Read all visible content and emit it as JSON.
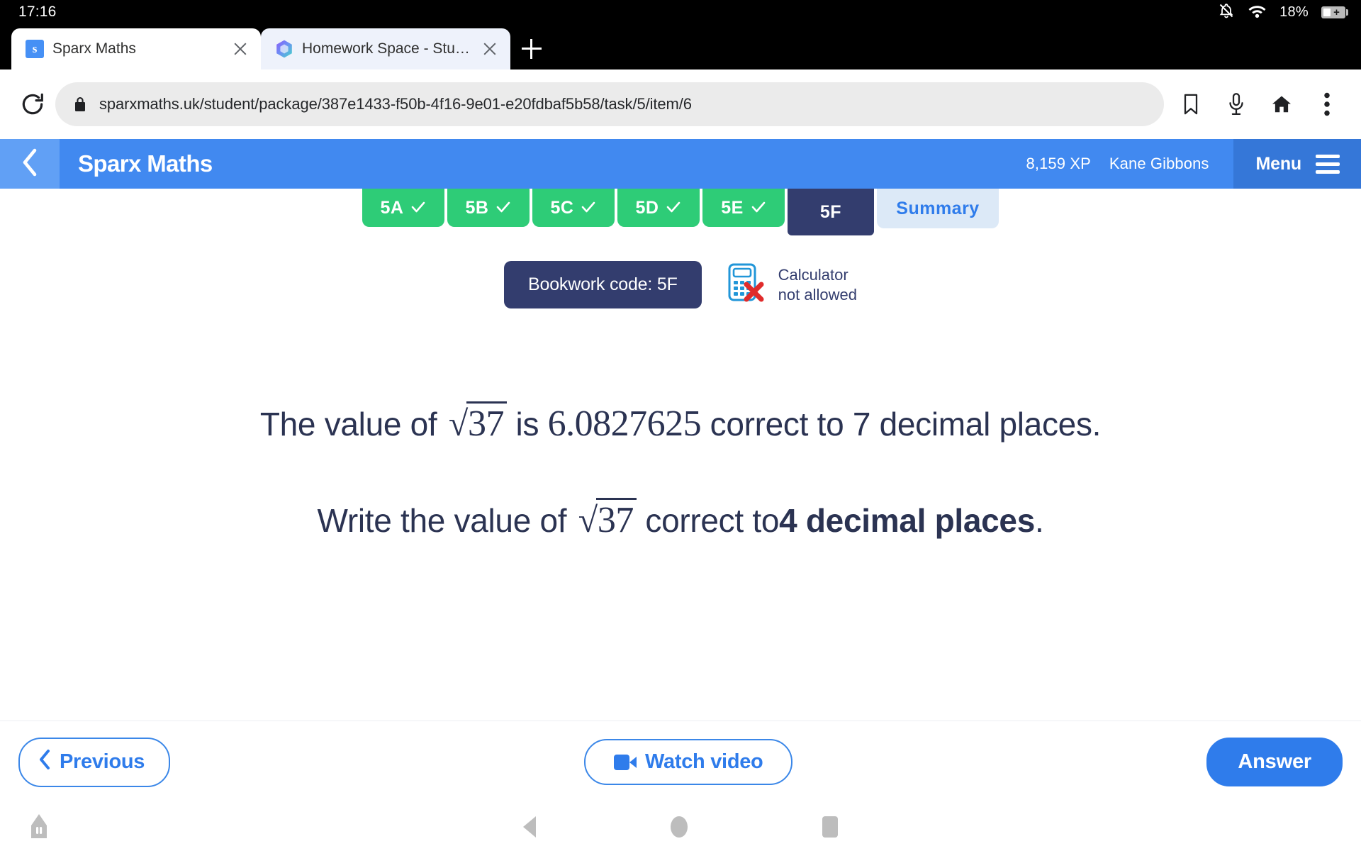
{
  "status_bar": {
    "time": "17:16",
    "battery_percent": "18%",
    "icons": [
      "bell-muted-icon",
      "wifi-icon",
      "battery-charging-icon"
    ]
  },
  "browser": {
    "tabs": [
      {
        "title": "Sparx Maths",
        "favicon": "sparx-favicon",
        "active": false
      },
      {
        "title": "Homework Space - StudyX",
        "favicon": "studyx-favicon",
        "active": true
      }
    ],
    "new_tab_label": "+",
    "reload_icon": "reload-icon",
    "url": "sparxmaths.uk/student/package/387e1433-f50b-4f16-9e01-e20fdbaf5b58/task/5/item/6",
    "lock_icon": "lock-icon",
    "actions": [
      "bookmark-icon",
      "microphone-icon",
      "home-icon",
      "overflow-menu-icon"
    ]
  },
  "app_header": {
    "back_icon": "chevron-left-icon",
    "brand": "Sparx Maths",
    "xp": "8,159 XP",
    "user": "Kane Gibbons",
    "menu_label": "Menu",
    "menu_icon": "hamburger-icon",
    "bg_color": "#4189f0",
    "menu_bg_color": "#3577d8"
  },
  "task_tabs": [
    {
      "label": "5A",
      "state": "done"
    },
    {
      "label": "5B",
      "state": "done"
    },
    {
      "label": "5C",
      "state": "done"
    },
    {
      "label": "5D",
      "state": "done"
    },
    {
      "label": "5E",
      "state": "done"
    },
    {
      "label": "5F",
      "state": "active"
    },
    {
      "label": "Summary",
      "state": "summary"
    }
  ],
  "meta": {
    "bookwork_code": "Bookwork code: 5F",
    "calculator_line1": "Calculator",
    "calculator_line2": "not allowed",
    "calculator_icon": "calculator-not-allowed-icon"
  },
  "question": {
    "line1_a": "The value of",
    "line1_radicand": "37",
    "line1_b": "is",
    "line1_value": "6.0827625",
    "line1_c": "correct to 7 decimal places.",
    "line2_a": "Write the value of",
    "line2_radicand": "37",
    "line2_b": "correct to",
    "line2_emphasis": "4 decimal places",
    "line2_c": "."
  },
  "bottom_bar": {
    "previous_label": "Previous",
    "previous_icon": "chevron-left-icon",
    "video_label": "Watch video",
    "video_icon": "video-camera-icon",
    "answer_label": "Answer"
  },
  "nav_bar": {
    "pen_icon": "stylus-icon",
    "back_icon": "nav-back-icon",
    "home_icon": "nav-home-icon",
    "recents_icon": "nav-recents-icon"
  },
  "colors": {
    "accent_blue": "#2f7ceb",
    "header_blue": "#4189f0",
    "navy": "#333d6e",
    "green": "#2ecc77",
    "summary_bg": "#dce9f7"
  }
}
